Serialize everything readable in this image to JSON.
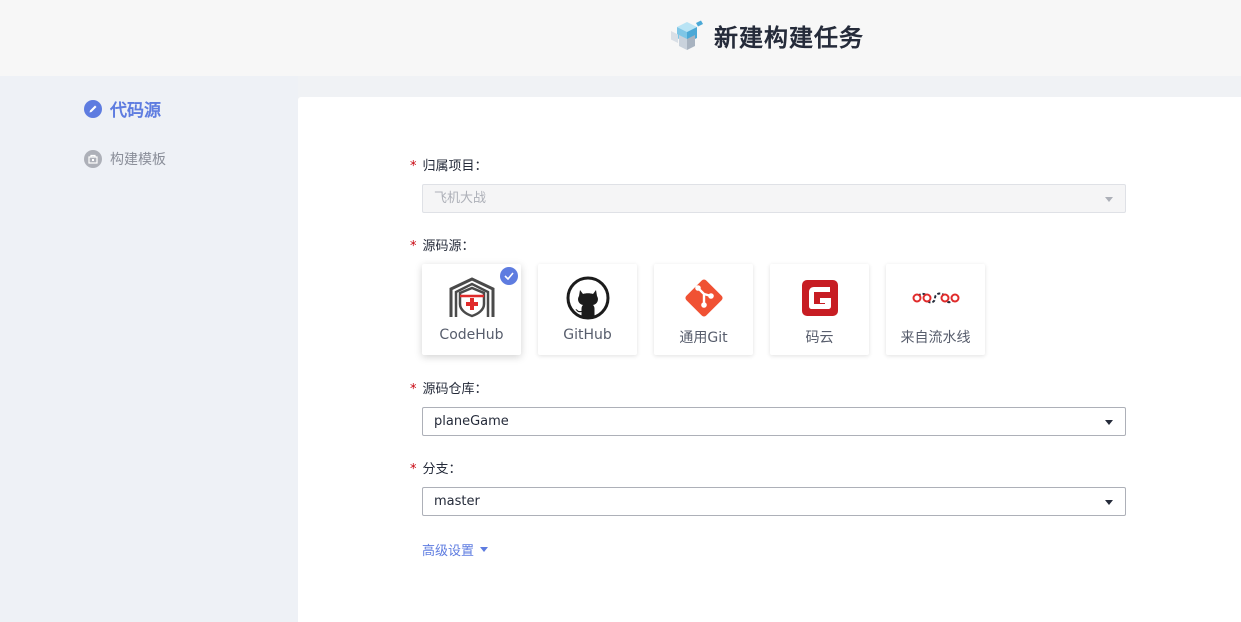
{
  "header": {
    "title": "新建构建任务",
    "icon": "cube-stack-icon"
  },
  "sidebar": {
    "steps": [
      {
        "label": "代码源",
        "icon": "pencil-icon",
        "active": true
      },
      {
        "label": "构建模板",
        "icon": "template-icon",
        "active": false
      }
    ]
  },
  "form": {
    "project": {
      "label": "归属项目：",
      "value": "飞机大战",
      "disabled": true
    },
    "source": {
      "label": "源码源：",
      "options": [
        {
          "label": "CodeHub",
          "icon": "codehub-icon",
          "selected": true
        },
        {
          "label": "GitHub",
          "icon": "github-icon",
          "selected": false
        },
        {
          "label": "通用Git",
          "icon": "git-icon",
          "selected": false
        },
        {
          "label": "码云",
          "icon": "gitee-icon",
          "selected": false
        },
        {
          "label": "来自流水线",
          "icon": "pipeline-icon",
          "selected": false
        }
      ]
    },
    "repo": {
      "label": "源码仓库：",
      "value": "planeGame"
    },
    "branch": {
      "label": "分支：",
      "value": "master"
    },
    "advanced": {
      "label": "高级设置"
    },
    "required_mark": "*"
  },
  "colors": {
    "accent": "#5e7ce0",
    "required": "#c7000b",
    "git": "#f05133",
    "gitee": "#c71d23"
  }
}
